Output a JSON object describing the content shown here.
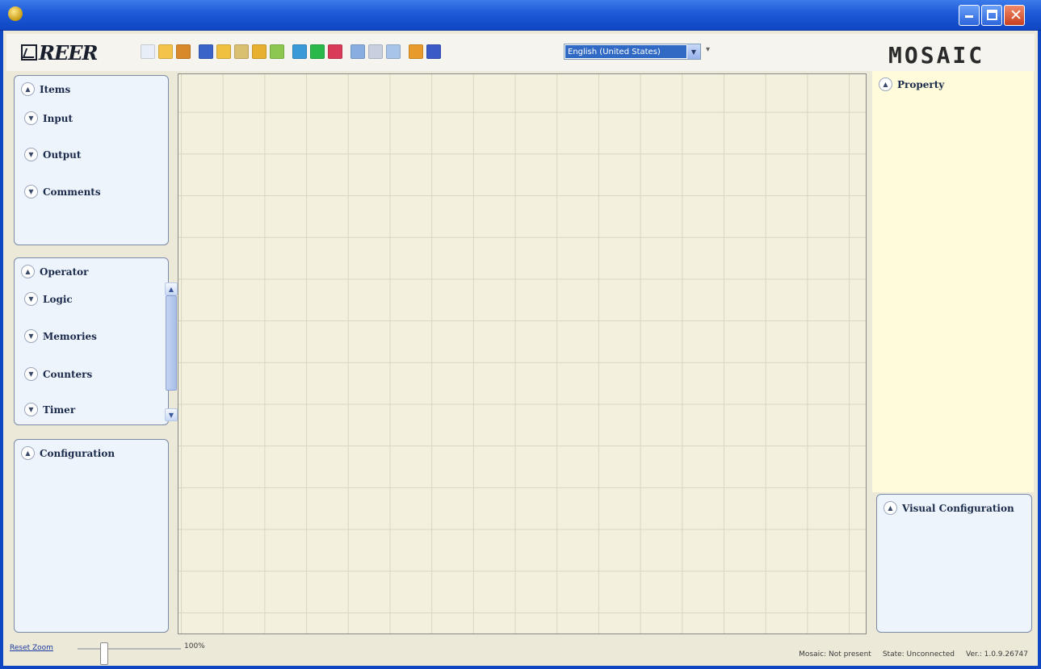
{
  "window": {
    "close_glyph": "✕"
  },
  "toolbar": {
    "reer_logo": "REER",
    "mosaic_logo": "MOSAIC",
    "language": "English (United States)",
    "icons": [
      {
        "name": "new-icon",
        "color": "#e8eef8"
      },
      {
        "name": "open-icon",
        "color": "#f4c34a"
      },
      {
        "name": "pin-icon",
        "color": "#d88a2a"
      },
      {
        "name": "save-icon",
        "color": "#3b64c8"
      },
      {
        "name": "folder-icon",
        "color": "#f0c040"
      },
      {
        "name": "print-icon",
        "color": "#d8c070"
      },
      {
        "name": "edit-icon",
        "color": "#e8b030"
      },
      {
        "name": "check-icon",
        "color": "#8cc850"
      },
      {
        "name": "connect-icon",
        "color": "#3a9ad8"
      },
      {
        "name": "globe-icon",
        "color": "#2ab84a"
      },
      {
        "name": "target-icon",
        "color": "#d83a58"
      },
      {
        "name": "zoom-icon",
        "color": "#88aee0"
      },
      {
        "name": "monitor-icon",
        "color": "#c8d0e0"
      },
      {
        "name": "chat-icon",
        "color": "#a8c4e8"
      },
      {
        "name": "tools-icon",
        "color": "#e89a2a"
      },
      {
        "name": "help-icon",
        "color": "#3a5ac8"
      }
    ]
  },
  "items_panel": {
    "title": "Items",
    "entries": [
      "Input",
      "Output",
      "Comments"
    ]
  },
  "operator_panel": {
    "title": "Operator",
    "entries": [
      "Logic",
      "Memories",
      "Counters",
      "Timer"
    ]
  },
  "configuration_panel": {
    "title": "Configuration"
  },
  "property_panel": {
    "title": "Property"
  },
  "visual_panel": {
    "title": "Visual Configuration"
  },
  "status": {
    "reset_zoom": "Reset Zoom",
    "zoom": "100%",
    "zoom_level": 0.26,
    "mosaic": "Mosaic: Not present",
    "state": "State: Unconnected",
    "version": "Ver.: 1.0.9.26747"
  }
}
